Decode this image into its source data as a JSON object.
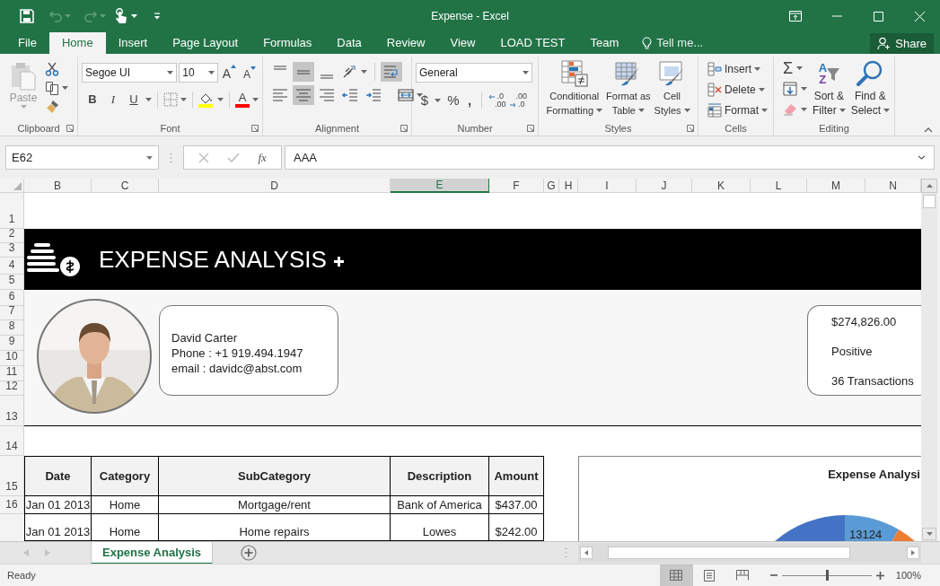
{
  "window": {
    "title": "Expense - Excel"
  },
  "menu_tabs": [
    {
      "label": "File",
      "selected": false
    },
    {
      "label": "Home",
      "selected": true
    },
    {
      "label": "Insert",
      "selected": false
    },
    {
      "label": "Page Layout",
      "selected": false
    },
    {
      "label": "Formulas",
      "selected": false
    },
    {
      "label": "Data",
      "selected": false
    },
    {
      "label": "Review",
      "selected": false
    },
    {
      "label": "View",
      "selected": false
    },
    {
      "label": "LOAD TEST",
      "selected": false
    },
    {
      "label": "Team",
      "selected": false
    }
  ],
  "tell_me": "Tell me...",
  "share_button": "Share",
  "ribbon": {
    "clipboard": {
      "label": "Clipboard",
      "paste": "Paste"
    },
    "font": {
      "label": "Font",
      "name": "Segoe UI",
      "size": "10",
      "grow": "A",
      "shrink": "A",
      "bold": "B",
      "italic": "I",
      "underline": "U",
      "font_color": "A"
    },
    "alignment": {
      "label": "Alignment",
      "buttons": [
        {
          "kind": "top",
          "selected": false
        },
        {
          "kind": "middle",
          "selected": true
        },
        {
          "kind": "bottom",
          "selected": false
        },
        {
          "kind": "orientation",
          "selected": false
        },
        {
          "kind": "wrap",
          "selected": true
        },
        {
          "kind": "left",
          "selected": false
        },
        {
          "kind": "center",
          "selected": true
        },
        {
          "kind": "right",
          "selected": false
        },
        {
          "kind": "outdent",
          "selected": false
        },
        {
          "kind": "indent",
          "selected": false
        },
        {
          "kind": "merge",
          "selected": false
        }
      ]
    },
    "number": {
      "label": "Number",
      "format": "General",
      "currency": "$",
      "percent": "%",
      "comma": ",",
      "increase_decimal": [
        ".0",
        ".00"
      ],
      "decrease_decimal": [
        ".00",
        ".0"
      ]
    },
    "styles": {
      "label": "Styles",
      "buttons": [
        {
          "kind": "conditional",
          "lines": [
            "Conditional",
            "Formatting"
          ]
        },
        {
          "kind": "table",
          "lines": [
            "Format as",
            "Table"
          ]
        },
        {
          "kind": "cell",
          "lines": [
            "Cell",
            "Styles"
          ]
        }
      ]
    },
    "cells": {
      "label": "Cells",
      "buttons": [
        {
          "kind": "insert",
          "label": "Insert"
        },
        {
          "kind": "delete",
          "label": "Delete"
        },
        {
          "kind": "format",
          "label": "Format"
        }
      ]
    },
    "editing": {
      "label": "Editing",
      "autosum": "Σ",
      "sort_letters": [
        "A",
        "Z"
      ],
      "sort": [
        "Sort &",
        "Filter"
      ],
      "find": [
        "Find &",
        "Select"
      ]
    }
  },
  "formula_bar": {
    "name_box": "E62",
    "fx": "fx",
    "value": "AAA"
  },
  "columns": [
    {
      "label": "B",
      "selected": false
    },
    {
      "label": "C",
      "selected": false
    },
    {
      "label": "D",
      "selected": false
    },
    {
      "label": "E",
      "selected": true
    },
    {
      "label": "F",
      "selected": false
    },
    {
      "label": "G",
      "selected": false
    },
    {
      "label": "H",
      "selected": false
    },
    {
      "label": "I",
      "selected": false
    },
    {
      "label": "J",
      "selected": false
    },
    {
      "label": "K",
      "selected": false
    },
    {
      "label": "L",
      "selected": false
    },
    {
      "label": "M",
      "selected": false
    },
    {
      "label": "N",
      "selected": false
    }
  ],
  "row_numbers": [
    "1",
    "2",
    "3",
    "4",
    "5",
    "6",
    "7",
    "8",
    "9",
    "10",
    "11",
    "12",
    "13",
    "14",
    "15",
    "16"
  ],
  "sheet": {
    "banner_title": "EXPENSE ANALYSIS",
    "contact": {
      "name": "David Carter",
      "phone": "Phone : +1 919.494.1947",
      "email": "email : davidc@abst.com"
    },
    "summary": [
      "$274,826.00",
      "Positive",
      "36 Transactions"
    ],
    "table": {
      "columns": [
        "Date",
        "Category",
        "SubCategory",
        "Description",
        "Amount"
      ],
      "rows": [
        [
          "Jan 01 2013",
          "Home",
          "Mortgage/rent",
          "Bank of America",
          "$437.00"
        ],
        [
          "Jan 01 2013",
          "Home",
          "Home repairs",
          "Lowes",
          "$242.00"
        ]
      ]
    },
    "chart": {
      "title": "Expense Analysi",
      "data_label": "13124"
    }
  },
  "sheet_tabs": [
    {
      "label": "Expense Analysis",
      "selected": true
    }
  ],
  "status_bar": {
    "status": "Ready",
    "views": [
      {
        "kind": "normal",
        "selected": true
      },
      {
        "kind": "page_layout",
        "selected": false
      },
      {
        "kind": "page_break",
        "selected": false
      }
    ],
    "zoom_slider": {
      "level": 0.5
    },
    "zoom": "100%"
  }
}
